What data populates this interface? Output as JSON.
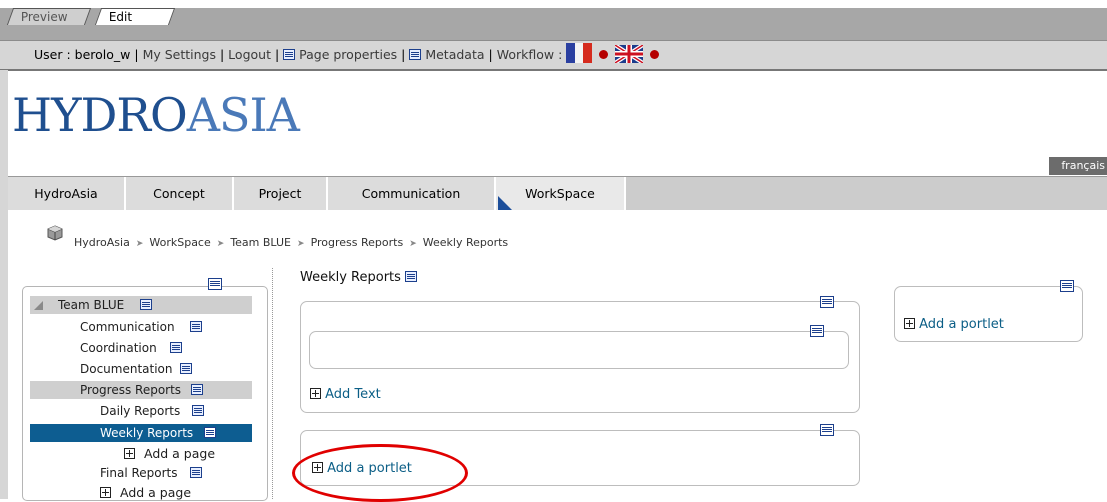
{
  "mode_tabs": {
    "preview": "Preview",
    "edit": "Edit"
  },
  "userbar": {
    "user": "User : berolo_w",
    "my_settings": "My Settings",
    "logout": "Logout",
    "page_properties": "Page properties",
    "metadata": "Metadata",
    "workflow": "Workflow :"
  },
  "logo": {
    "bold": "HYDRO",
    "light": "ASIA"
  },
  "language_switch": "français",
  "nav": [
    "HydroAsia",
    "Concept",
    "Project",
    "Communication",
    "WorkSpace"
  ],
  "breadcrumb": [
    "HydroAsia",
    "WorkSpace",
    "Team BLUE",
    "Progress Reports",
    "Weekly Reports"
  ],
  "tree": {
    "root": "Team BLUE",
    "items": [
      "Communication",
      "Coordination",
      "Documentation",
      "Progress Reports"
    ],
    "sub": [
      "Daily Reports",
      "Weekly Reports"
    ],
    "add_page": "Add a page",
    "final": "Final Reports"
  },
  "center": {
    "title": "Weekly Reports",
    "add_text": "Add Text",
    "add_portlet": "Add a portlet"
  },
  "right": {
    "add_portlet": "Add a portlet"
  },
  "colors": {
    "accent": "#0d5d91",
    "logo": "#1f4f8f",
    "highlight_circle": "#e00000"
  }
}
